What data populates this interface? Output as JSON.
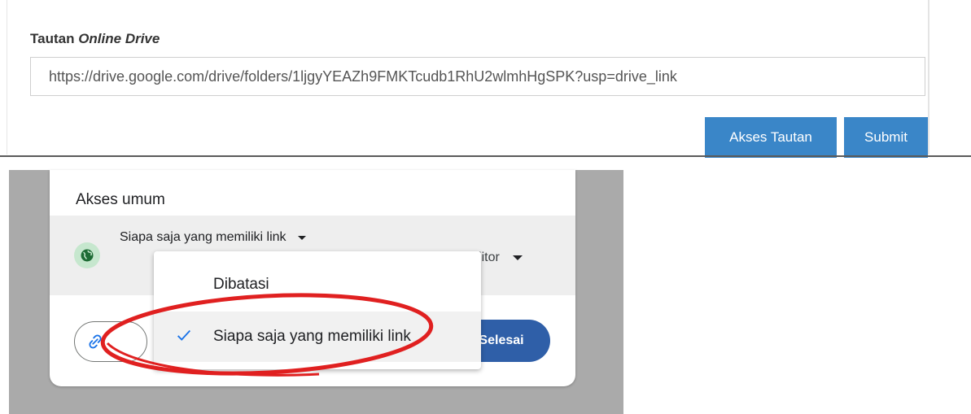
{
  "form": {
    "label_prefix": "Tautan",
    "label_italic": "Online Drive",
    "url_value": "https://drive.google.com/drive/folders/1ljgyYEAZh9FMKTcudb1RhU2wlmhHgSPK?usp=drive_link",
    "buttons": {
      "akses_tautan": "Akses Tautan",
      "submit": "Submit"
    },
    "button_color": "#3a86c8"
  },
  "share_dialog": {
    "section_title": "Akses umum",
    "general_access_value": "Siapa saja yang memiliki link",
    "role_value": "Editor",
    "globe_icon": "globe-icon",
    "done_label": "Selesai",
    "done_color": "#2f5fa8",
    "copy_link_icon": "link-icon",
    "menu": {
      "items": [
        {
          "label": "Dibatasi",
          "selected": false
        },
        {
          "label": "Siapa saja yang memiliki link",
          "selected": true
        }
      ]
    },
    "annotation": {
      "shape": "ellipse",
      "color": "#e02020",
      "target": "Siapa saja yang memiliki link"
    }
  }
}
